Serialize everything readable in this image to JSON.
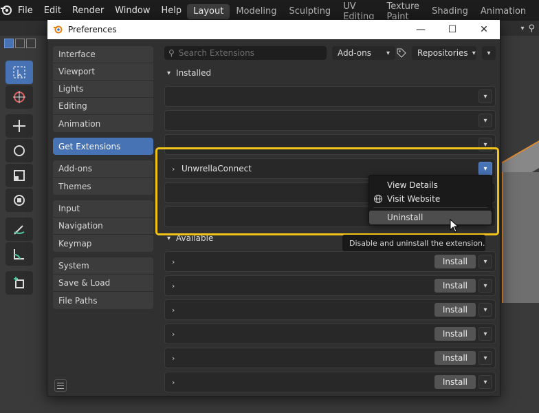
{
  "topbar": {
    "menus": [
      "File",
      "Edit",
      "Render",
      "Window",
      "Help"
    ],
    "workspaces": [
      "Layout",
      "Modeling",
      "Sculpting",
      "UV Editing",
      "Texture Paint",
      "Shading",
      "Animation",
      "R"
    ],
    "active_workspace": "Layout"
  },
  "window": {
    "title": "Preferences"
  },
  "sidebar": {
    "groups": [
      [
        "Interface",
        "Viewport",
        "Lights",
        "Editing",
        "Animation"
      ],
      [
        "Get Extensions"
      ],
      [
        "Add-ons",
        "Themes"
      ],
      [
        "Input",
        "Navigation",
        "Keymap"
      ],
      [
        "System",
        "Save & Load",
        "File Paths"
      ]
    ],
    "active": "Get Extensions"
  },
  "toolbar": {
    "search_placeholder": "Search Extensions",
    "filter_label": "Add-ons",
    "repositories_label": "Repositories"
  },
  "sections": {
    "installed_label": "Installed",
    "available_label": "Available"
  },
  "installed_rows": [
    {
      "name": ""
    },
    {
      "name": ""
    },
    {
      "name": ""
    },
    {
      "name": "UnwrellaConnect"
    },
    {
      "name": ""
    },
    {
      "name": ""
    }
  ],
  "available_rows": [
    {
      "install_label": "Install"
    },
    {
      "install_label": "Install"
    },
    {
      "install_label": "Install"
    },
    {
      "install_label": "Install"
    },
    {
      "install_label": "Install"
    },
    {
      "install_label": "Install"
    }
  ],
  "context_menu": {
    "items": [
      "View Details",
      "Visit Website",
      "Uninstall"
    ]
  },
  "tooltip": "Disable and uninstall the extension.",
  "colors": {
    "accent": "#4772b3",
    "highlight_frame": "#f2c418"
  }
}
